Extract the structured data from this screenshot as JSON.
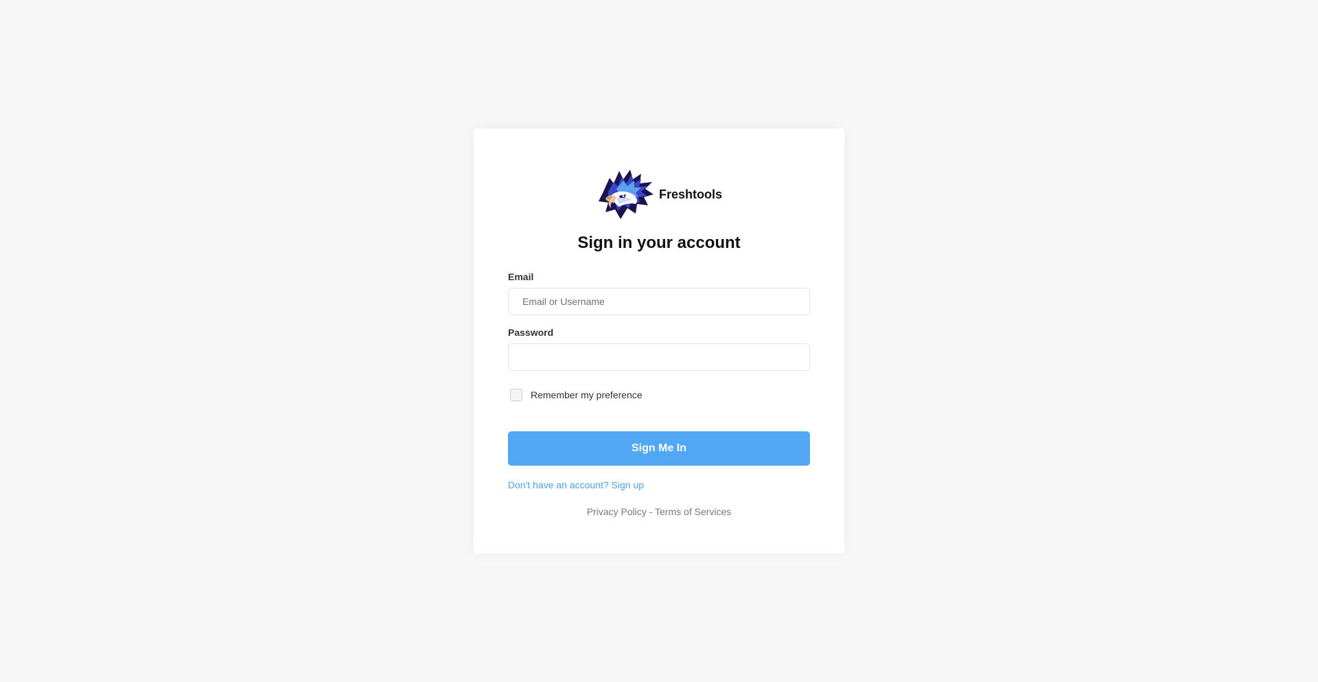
{
  "brand": {
    "name": "Freshtools",
    "logo_icon": "eagle-logo-icon"
  },
  "form": {
    "title": "Sign in your account",
    "email": {
      "label": "Email",
      "value": "",
      "placeholder": "Email or Username"
    },
    "password": {
      "label": "Password",
      "value": "",
      "placeholder": ""
    },
    "remember": {
      "label": "Remember my preference",
      "checked": false
    },
    "submit_label": "Sign Me In",
    "signup_link": "Don't have an account? Sign up"
  },
  "footer": {
    "privacy": "Privacy Policy",
    "separator": " - ",
    "terms": "Terms of Services"
  },
  "colors": {
    "background": "#f7f7f7",
    "card": "#ffffff",
    "primary_button": "#52a7f5",
    "link": "#4a9fe8",
    "muted_text": "#777777"
  }
}
